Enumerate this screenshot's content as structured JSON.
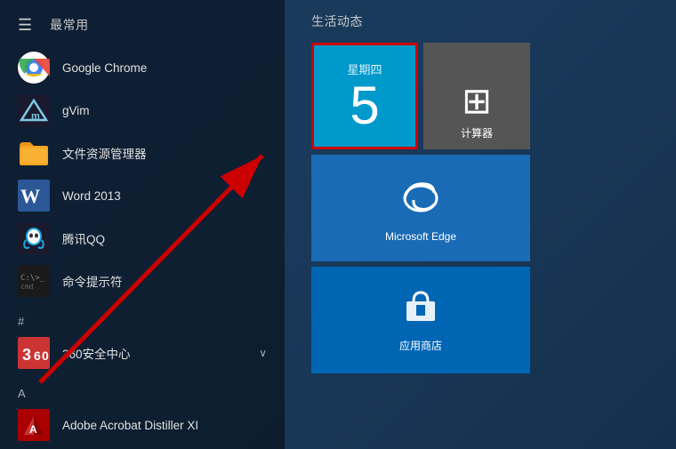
{
  "header": {
    "section_label": "最常用"
  },
  "apps": [
    {
      "name": "Google Chrome",
      "icon_type": "chrome"
    },
    {
      "name": "gVim",
      "icon_type": "vim"
    },
    {
      "name": "文件资源管理器",
      "icon_type": "folder"
    },
    {
      "name": "Word 2013",
      "icon_type": "word"
    },
    {
      "name": "腾讯QQ",
      "icon_type": "qq"
    },
    {
      "name": "命令提示符",
      "icon_type": "cmd"
    }
  ],
  "alpha_sections": [
    {
      "letter": "#",
      "items": [
        {
          "name": "360安全中心",
          "icon_type": "360",
          "has_arrow": true
        }
      ]
    },
    {
      "letter": "A",
      "items": [
        {
          "name": "Adobe Acrobat Distiller XI",
          "icon_type": "adobe",
          "has_arrow": false
        }
      ]
    }
  ],
  "live_section": {
    "label": "生活动态",
    "tiles": [
      {
        "type": "calendar",
        "day_label": "星期四",
        "day_number": "5"
      },
      {
        "type": "calculator",
        "label": "计算器"
      },
      {
        "type": "edge",
        "label": "Microsoft Edge"
      },
      {
        "type": "store",
        "label": "应用商店"
      }
    ]
  }
}
